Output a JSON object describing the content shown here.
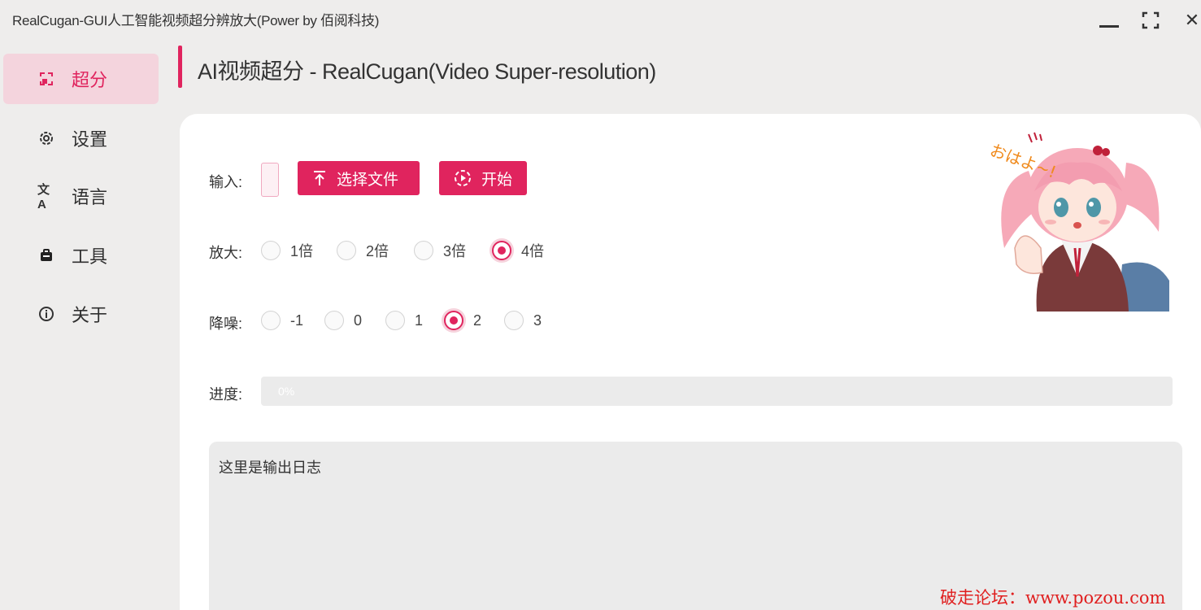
{
  "window": {
    "title": "RealCugan-GUI人工智能视频超分辨放大(Power by 佰阅科技)",
    "minimize_icon": "minimize-icon",
    "maximize_icon": "fullscreen-icon",
    "close_icon": "close-icon"
  },
  "sidebar": {
    "items": [
      {
        "label": "超分",
        "icon": "upscale-icon",
        "active": true
      },
      {
        "label": "设置",
        "icon": "gear-icon",
        "active": false
      },
      {
        "label": "语言",
        "icon": "translate-icon",
        "active": false
      },
      {
        "label": "工具",
        "icon": "toolbox-icon",
        "active": false
      },
      {
        "label": "关于",
        "icon": "info-icon",
        "active": false
      }
    ]
  },
  "page": {
    "title": "AI视频超分 - RealCugan(Video Super-resolution)"
  },
  "form": {
    "input_label": "输入:",
    "select_file_label": "选择文件",
    "start_label": "开始",
    "scale_label": "放大:",
    "scale_options": [
      "1倍",
      "2倍",
      "3倍",
      "4倍"
    ],
    "scale_selected": "4倍",
    "denoise_label": "降噪:",
    "denoise_options": [
      "-1",
      "0",
      "1",
      "2",
      "3"
    ],
    "denoise_selected": "2",
    "progress_label": "进度:",
    "progress_text": "0%",
    "progress_value": 0,
    "log_text": "这里是输出日志"
  },
  "mascot": {
    "text": "おはよ~!"
  },
  "watermark": "破走论坛：www.pozou.com",
  "colors": {
    "accent": "#e0245e",
    "accent_light": "#f4d4dd",
    "background": "#eeedec",
    "card": "#ffffff",
    "log_bg": "#ebebeb"
  }
}
